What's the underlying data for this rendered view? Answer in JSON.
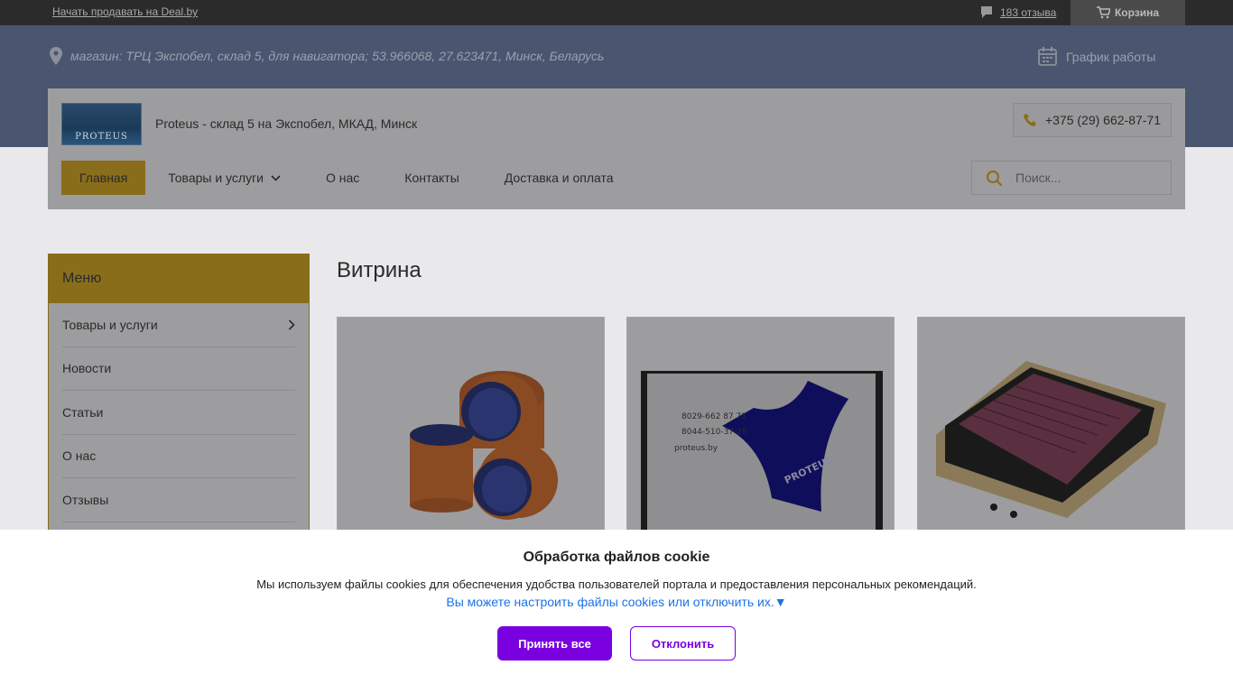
{
  "topbar": {
    "sell_link": "Начать продавать на Deal.by",
    "reviews": "183 отзыва",
    "cart": "Корзина"
  },
  "hero": {
    "address": "магазин: ТРЦ Экспобел, склад 5, для навигатора; 53.966068, 27.623471, Минск, Беларусь",
    "schedule": "График работы"
  },
  "header": {
    "logo_text": "PROTEUS",
    "shop_name": "Proteus - склад 5 на Экспобел, МКАД, Минск",
    "phone": "+375 (29) 662-87-71",
    "search_placeholder": "Поиск..."
  },
  "nav": {
    "items": [
      "Главная",
      "Товары и услуги",
      "О нас",
      "Контакты",
      "Доставка и оплата"
    ]
  },
  "sidebar": {
    "title": "Меню",
    "items": [
      "Товары и услуги",
      "Новости",
      "Статьи",
      "О нас",
      "Отзывы"
    ]
  },
  "main": {
    "title": "Витрина",
    "products": [
      {
        "image": "orange-silicone-couplers"
      },
      {
        "image": "blue-silicone-elbow",
        "photo_text": [
          "8029-662 87 71",
          "8044-510-37-28",
          "proteus.by",
          "PROTEUS"
        ]
      },
      {
        "image": "air-filter"
      }
    ]
  },
  "cookie": {
    "title": "Обработка файлов cookie",
    "description": "Мы используем файлы cookies для обеспечения удобства пользователей портала и предоставления персональных рекомендаций.",
    "settings_link": "Вы можете настроить файлы cookies или отключить их.▼",
    "accept": "Принять все",
    "decline": "Отклонить"
  },
  "colors": {
    "accent": "#e0b012",
    "cookie_button": "#7b00e0",
    "link": "#1a73e8"
  }
}
